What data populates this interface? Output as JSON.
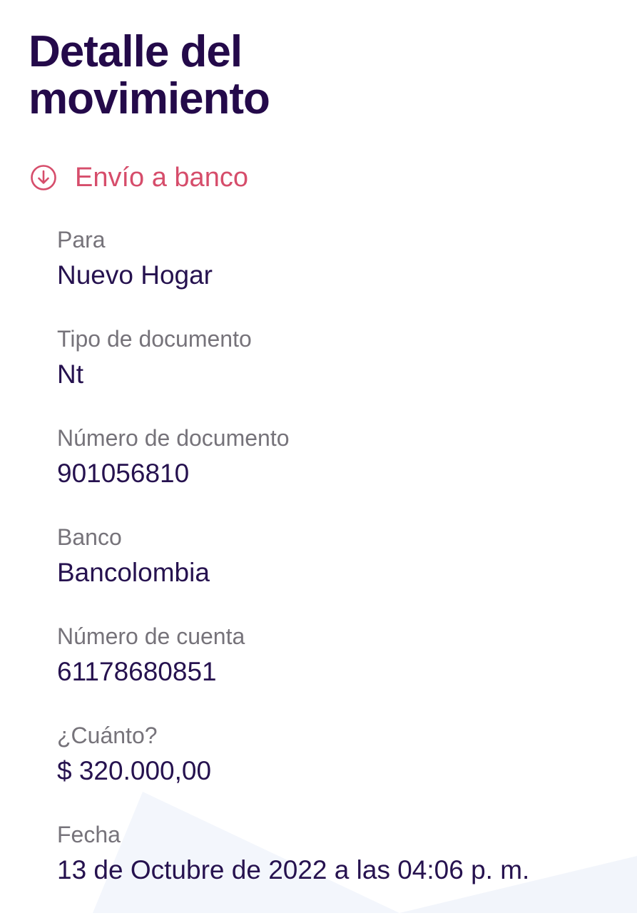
{
  "header": {
    "title_line1": "Detalle del",
    "title_line2": "movimiento"
  },
  "movement": {
    "type_label": "Envío a banco",
    "type_icon": "arrow-down-circle-icon",
    "accent_color": "#d64d6b"
  },
  "fields": [
    {
      "label": "Para",
      "value": "Nuevo Hogar"
    },
    {
      "label": "Tipo de documento",
      "value": "Nt"
    },
    {
      "label": "Número de documento",
      "value": "901056810"
    },
    {
      "label": "Banco",
      "value": "Bancolombia"
    },
    {
      "label": "Número de cuenta",
      "value": "61178680851"
    },
    {
      "label": "¿Cuánto?",
      "value": "$ 320.000,00"
    },
    {
      "label": "Fecha",
      "value": "13 de Octubre de 2022 a las 04:06 p. m."
    }
  ],
  "colors": {
    "title": "#240a4a",
    "label": "#76737a",
    "value": "#26124f"
  }
}
